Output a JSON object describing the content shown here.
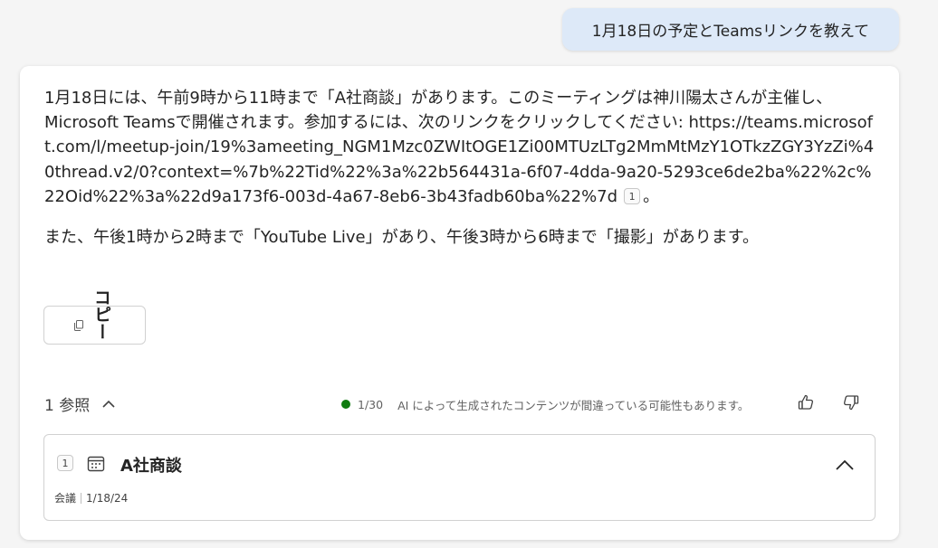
{
  "user_message": "1月18日の予定とTeamsリンクを教えて",
  "response": {
    "p1_before": "1月18日には、午前9時から11時まで「A社商談」があります。このミーティングは神川陽太さんが主催し、Microsoft Teamsで開催されます。参加するには、次のリンクをクリックしてください: ",
    "p1_link": "https://teams.microsoft.com/l/meetup-join/19%3ameeting_NGM1Mzc0ZWItOGE1Zi00MTUzLTg2MmMtMzY1OTkzZGY3YzZi%40thread.v2/0?context=%7b%22Tid%22%3a%22b564431a-6f07-4dda-9a20-5293ce6de2ba%22%2c%22Oid%22%3a%22d9a173f6-003d-4a67-8eb6-3b43fadb60ba%22%7d",
    "p1_citation": "1",
    "p1_after": "。",
    "p2": "また、午後1時から2時まで「YouTube Live」があり、午後3時から6時まで「撮影」があります。"
  },
  "copy_button": {
    "label": "コピー",
    "icon": "copy-icon"
  },
  "references": {
    "toggle_label": "1 参照",
    "toggle_icon": "chevron-up-icon"
  },
  "status": {
    "indicator_color": "#107c10",
    "count": "1/30",
    "disclaimer": "AI によって生成されたコンテンツが間違っている可能性もあります。"
  },
  "feedback": {
    "like_icon": "thumbs-up-icon",
    "dislike_icon": "thumbs-down-icon"
  },
  "reference_card": {
    "number": "1",
    "icon": "calendar-icon",
    "title": "A社商談",
    "type": "会議",
    "date": "1/18/24",
    "collapse_icon": "chevron-up-icon"
  }
}
